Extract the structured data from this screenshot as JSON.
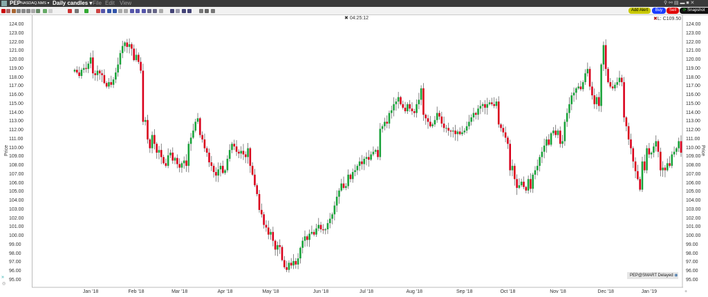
{
  "titlebar": {
    "symbol": "PEP",
    "exchange": "NASDAQ.NMS ▾",
    "chart_type": "Daily candles ▾",
    "menus": [
      "File",
      "Edit",
      "View"
    ]
  },
  "toolbar": {
    "icons": [
      "close-icon",
      "crosshair-icon",
      "pointer-icon",
      "grid-icon",
      "print-icon",
      "link-icon",
      "circle-icon",
      "compare-icon",
      "layout-icon",
      "blank-icon",
      "pen-icon",
      "bars-icon",
      "info-icon",
      "cross-icon",
      "trend-icon",
      "box-icon",
      "box2-icon",
      "undo-icon",
      "redo-icon",
      "fib-icon",
      "line-icon",
      "channel-icon",
      "zoom-in-icon",
      "zoom-out-icon",
      "square-icon",
      "align-left-icon",
      "align-right-icon",
      "split-icon",
      "move-icon",
      "settings-icon",
      "refresh-icon",
      "wrench-icon"
    ]
  },
  "actions": {
    "add_alert": "Add Alert",
    "buy": "Buy",
    "sell": "Sell",
    "snapshot": "Snapshot"
  },
  "colors": {
    "up": "#1aa33b",
    "down": "#d9001b",
    "wick": "#666666",
    "add_alert": "#c8c800",
    "buy": "#1a3cff",
    "sell": "#e00000",
    "snapshot": "#111111"
  },
  "crosshair_time": "04:25:12",
  "last_label": "L: C109.50",
  "status_badge": "PEP@SMART Delayed",
  "chart_data": {
    "type": "candlestick",
    "title": "PEP Daily candles",
    "ylabel": "Price",
    "ylim": [
      95,
      124
    ],
    "yticks": [
      "124.00",
      "123.00",
      "122.00",
      "121.00",
      "120.00",
      "119.00",
      "118.00",
      "117.00",
      "116.00",
      "115.00",
      "114.00",
      "113.00",
      "112.00",
      "111.00",
      "110.00",
      "109.00",
      "108.00",
      "107.00",
      "106.00",
      "105.00",
      "104.00",
      "103.00",
      "102.00",
      "101.00",
      "100.00",
      "99.00",
      "98.00",
      "97.00",
      "96.00",
      "95.00"
    ],
    "xticks": [
      {
        "label": "Jan '18",
        "index": 7
      },
      {
        "label": "Feb '18",
        "index": 27
      },
      {
        "label": "Mar '18",
        "index": 46
      },
      {
        "label": "Apr '18",
        "index": 66
      },
      {
        "label": "May '18",
        "index": 86
      },
      {
        "label": "Jun '18",
        "index": 108
      },
      {
        "label": "Jul '18",
        "index": 128
      },
      {
        "label": "Aug '18",
        "index": 149
      },
      {
        "label": "Sep '18",
        "index": 171
      },
      {
        "label": "Oct '18",
        "index": 190
      },
      {
        "label": "Nov '18",
        "index": 212
      },
      {
        "label": "Dec '18",
        "index": 233
      },
      {
        "label": "Jan '19",
        "index": 252
      }
    ],
    "closes": [
      118.9,
      118.6,
      118.2,
      118.9,
      119.1,
      119.0,
      119.6,
      120.3,
      118.5,
      118.3,
      118.8,
      118.5,
      118.3,
      117.4,
      117.0,
      117.5,
      117.2,
      117.8,
      118.6,
      119.5,
      120.8,
      121.6,
      122.0,
      121.5,
      121.8,
      121.3,
      120.0,
      120.6,
      119.8,
      118.8,
      113.0,
      113.2,
      111.0,
      110.0,
      111.5,
      110.5,
      109.5,
      109.8,
      109.0,
      108.3,
      108.0,
      109.2,
      109.5,
      108.6,
      108.9,
      108.2,
      107.8,
      108.3,
      108.6,
      108.0,
      110.5,
      111.2,
      112.0,
      113.0,
      113.4,
      111.5,
      111.0,
      110.0,
      109.5,
      108.4,
      108.0,
      107.3,
      106.9,
      107.6,
      108.0,
      107.2,
      107.5,
      108.8,
      109.8,
      110.5,
      110.2,
      109.6,
      109.4,
      109.7,
      109.3,
      109.0,
      110.0,
      108.0,
      107.0,
      105.8,
      104.8,
      103.0,
      102.5,
      101.3,
      101.0,
      100.2,
      100.5,
      99.5,
      98.5,
      99.0,
      98.8,
      97.3,
      96.5,
      96.2,
      97.0,
      96.7,
      97.2,
      96.8,
      97.5,
      98.7,
      99.5,
      100.0,
      99.6,
      100.3,
      100.5,
      100.2,
      100.9,
      101.3,
      100.8,
      100.7,
      100.8,
      101.5,
      102.0,
      102.5,
      103.5,
      104.5,
      105.2,
      106.0,
      105.5,
      105.7,
      107.0,
      106.5,
      107.3,
      107.5,
      108.0,
      108.5,
      108.2,
      108.8,
      109.0,
      108.7,
      109.3,
      109.6,
      109.8,
      109.0,
      112.2,
      112.5,
      113.0,
      112.8,
      114.0,
      114.3,
      115.0,
      115.3,
      115.8,
      115.0,
      114.6,
      114.2,
      115.0,
      114.5,
      114.2,
      114.0,
      115.0,
      115.5,
      116.8,
      113.8,
      113.4,
      113.0,
      112.5,
      112.7,
      113.2,
      114.0,
      113.6,
      112.8,
      112.3,
      112.3,
      112.0,
      111.9,
      112.0,
      111.6,
      111.9,
      111.6,
      111.8,
      112.0,
      112.5,
      113.0,
      113.5,
      114.0,
      113.8,
      114.5,
      114.8,
      115.0,
      114.6,
      115.0,
      115.2,
      115.0,
      114.8,
      115.3,
      112.7,
      112.3,
      111.8,
      111.2,
      110.5,
      107.5,
      108.0,
      106.5,
      105.5,
      105.8,
      106.2,
      105.6,
      105.2,
      106.5,
      105.4,
      107.0,
      107.5,
      108.0,
      109.0,
      109.6,
      110.3,
      111.0,
      110.4,
      111.7,
      112.0,
      111.5,
      112.0,
      110.5,
      110.8,
      113.0,
      114.0,
      115.0,
      116.0,
      116.3,
      116.8,
      117.0,
      116.7,
      117.5,
      118.5,
      119.0,
      117.0,
      116.0,
      115.0,
      115.8,
      114.8,
      119.5,
      121.7,
      119.0,
      117.5,
      117.0,
      116.8,
      117.2,
      117.5,
      118.0,
      117.5,
      113.5,
      112.5,
      111.0,
      110.0,
      108.5,
      107.4,
      106.5,
      105.3,
      108.5,
      107.5,
      110.0,
      109.3,
      109.5,
      110.2,
      110.8,
      109.6,
      107.5,
      107.8,
      107.5,
      108.3,
      108.0,
      109.3,
      109.6,
      110.0,
      110.8,
      109.5
    ],
    "first_open": 118.7,
    "last_close": 109.5,
    "grid": false
  }
}
